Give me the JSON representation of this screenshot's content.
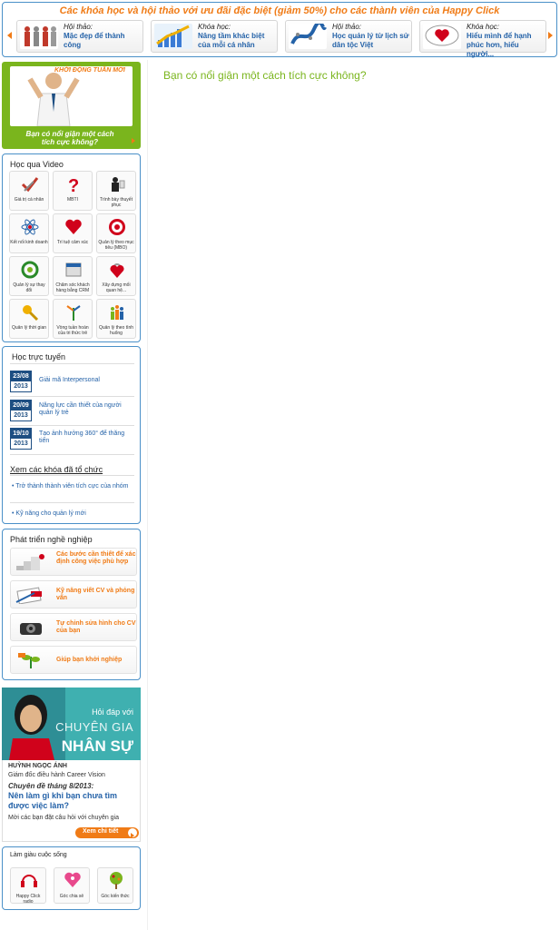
{
  "banner": {
    "title": "Các khóa học và hội thảo với ưu đãi đặc biệt (giảm 50%) cho các thành viên của Happy Click",
    "items": [
      {
        "kind": "Hội thảo:",
        "name": "Mặc đẹp để thành công"
      },
      {
        "kind": "Khóa học:",
        "name": "Nâng tầm khác biệt của mỗi cá nhân"
      },
      {
        "kind": "Hội thảo:",
        "name": "Học quản lý từ lịch sử dân tộc Việt"
      },
      {
        "kind": "Khóa học:",
        "name": "Hiểu mình để hạnh phúc hơn, hiểu người..."
      }
    ]
  },
  "hero": {
    "tag": "KHỞI ĐỘNG TUẦN MỚI",
    "caption": "Bạn có nổi giận một cách tích cực không?"
  },
  "video": {
    "title": "Học qua Video",
    "items": [
      {
        "label": "Giá trị cá nhân",
        "icon": "checkmark-icon"
      },
      {
        "label": "MBTI",
        "icon": "question-icon"
      },
      {
        "label": "Trình bày thuyết phục",
        "icon": "presenter-icon"
      },
      {
        "label": "Kết nối kinh doanh",
        "icon": "atom-icon"
      },
      {
        "label": "Trí tuệ cảm xúc",
        "icon": "heart-icon"
      },
      {
        "label": "Quản lý theo mục tiêu (MBO)",
        "icon": "target-icon"
      },
      {
        "label": "Quản lý sự thay đổi",
        "icon": "recycle-icon"
      },
      {
        "label": "Chăm sóc khách hàng bằng CRM",
        "icon": "crm-icon"
      },
      {
        "label": "Xây dựng mối quan hệ...",
        "icon": "lock-heart-icon"
      },
      {
        "label": "Quản lý thời gian",
        "icon": "key-icon"
      },
      {
        "label": "Vòng tuần hoàn của tri thức trẻ",
        "icon": "arrows-icon"
      },
      {
        "label": "Quản lý theo tình huống",
        "icon": "people-icon"
      }
    ]
  },
  "online": {
    "title": "Học trực tuyến",
    "courses": [
      {
        "day": "23/08",
        "year": "2013",
        "title": "Giải mã Interpersonal"
      },
      {
        "day": "20/09",
        "year": "2013",
        "title": "Năng lực cần thiết của người quản lý trẻ"
      },
      {
        "day": "19/10",
        "year": "2013",
        "title": "Tạo ảnh hưởng 360° để thăng tiến"
      }
    ],
    "org_title": "Xem các khóa đã tổ chức",
    "org_links": [
      "• Trở thành thành viên tích cực của nhóm",
      "• Kỹ năng cho quản lý mới"
    ]
  },
  "career": {
    "title": "Phát triển nghề nghiệp",
    "items": [
      "Các bước cần thiết để xác định công việc phù hợp",
      "Kỹ năng viết CV và phỏng vấn",
      "Tự chỉnh sửa hình cho CV của bạn",
      "Giúp bạn khởi nghiệp"
    ]
  },
  "expert": {
    "ask": "Hỏi đáp với",
    "l1": "CHUYÊN GIA",
    "l2": "NHÂN SỰ",
    "name": "HUỲNH NGỌC ÁNH",
    "role": "Giám đốc điều hành Career Vision",
    "topic_label": "Chuyên đề tháng 8/2013:",
    "topic": "Nên làm gì khi bạn chưa tìm được việc làm?",
    "invite": "Mời các bạn đặt câu hỏi với chuyên gia",
    "button": "Xem chi tiết"
  },
  "rich": {
    "title": "Làm giàu cuộc sống",
    "items": [
      {
        "label": "Happy Click radio",
        "icon": "headphones-icon"
      },
      {
        "label": "Góc chia sẻ",
        "icon": "share-heart-icon"
      },
      {
        "label": "Góc kiến thức",
        "icon": "tree-icon"
      }
    ]
  },
  "content": {
    "title": "Bạn có nổi giận một cách tích cực không?"
  },
  "colors": {
    "accent": "#f07b16",
    "green": "#7ab51d",
    "blue": "#2462a8",
    "border": "#4a90c8"
  }
}
